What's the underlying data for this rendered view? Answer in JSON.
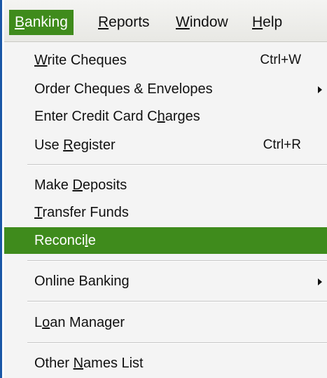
{
  "menubar": {
    "items": [
      {
        "pre": "",
        "key": "B",
        "post": "anking"
      },
      {
        "pre": "",
        "key": "R",
        "post": "eports"
      },
      {
        "pre": "",
        "key": "W",
        "post": "indow"
      },
      {
        "pre": "",
        "key": "H",
        "post": "elp"
      }
    ]
  },
  "menu": {
    "items": [
      {
        "pre": "",
        "key": "W",
        "post": "rite Cheques",
        "shortcut": "Ctrl+W"
      },
      {
        "pre": "Order Cheques & Envelopes",
        "key": "",
        "post": ""
      },
      {
        "pre": "Enter Credit Card C",
        "key": "h",
        "post": "arges"
      },
      {
        "pre": "Use ",
        "key": "R",
        "post": "egister",
        "shortcut": "Ctrl+R"
      },
      {
        "pre": "Make ",
        "key": "D",
        "post": "eposits"
      },
      {
        "pre": "",
        "key": "T",
        "post": "ransfer Funds"
      },
      {
        "pre": "Reconci",
        "key": "l",
        "post": "e"
      },
      {
        "pre": "Online Banking",
        "key": "",
        "post": ""
      },
      {
        "pre": "L",
        "key": "o",
        "post": "an Manager"
      },
      {
        "pre": "Other ",
        "key": "N",
        "post": "ames List"
      }
    ]
  }
}
